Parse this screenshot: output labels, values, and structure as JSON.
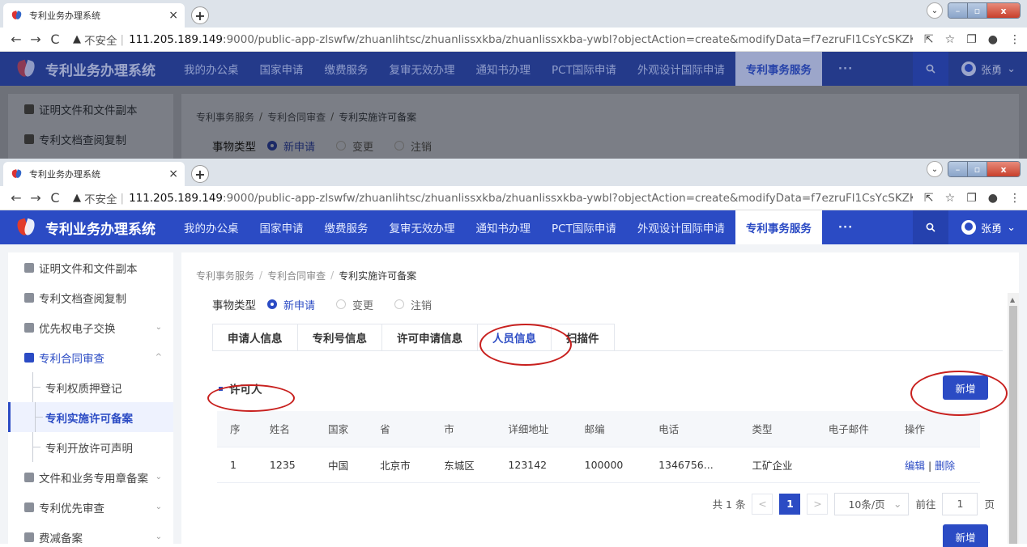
{
  "browser": {
    "tab_title": "专利业务办理系统",
    "tab_close": "×",
    "new_tab": "+",
    "dropdown": "⌄",
    "win_min": "–",
    "win_max": "▫",
    "win_close": "x",
    "back": "←",
    "forward": "→",
    "reload": "C",
    "insecure_label": "不安全",
    "url_host": "111.205.189.149",
    "url_path": ":9000/public-app-zlswfw/zhuanlihtsc/zhuanlissxkba/zhuanlissxkba-ywbl?objectAction=create&modifyData=f7ezruFl1CsYcSKZKB..."
  },
  "header": {
    "app_title": "专利业务办理系统",
    "nav": [
      "我的办公桌",
      "国家申请",
      "缴费服务",
      "复审无效办理",
      "通知书办理",
      "PCT国际申请",
      "外观设计国际申请",
      "专利事务服务",
      "···"
    ],
    "active_nav": "专利事务服务",
    "user_name": "张勇",
    "user_chevron": "⌄"
  },
  "sidebar": {
    "items": [
      {
        "label": "证明文件和文件副本"
      },
      {
        "label": "专利文档查阅复制"
      },
      {
        "label": "优先权电子交换",
        "chevron": "⌄"
      },
      {
        "label": "专利合同审查",
        "chevron": "^"
      }
    ],
    "subitems": [
      "专利权质押登记",
      "专利实施许可备案",
      "专利开放许可声明"
    ],
    "after_items": [
      {
        "label": "文件和业务专用章备案",
        "chevron": "⌄"
      },
      {
        "label": "专利优先审查",
        "chevron": "⌄"
      },
      {
        "label": "费减备案",
        "chevron": "⌄"
      }
    ]
  },
  "breadcrumb": {
    "items": [
      "专利事务服务",
      "专利合同审查",
      "专利实施许可备案"
    ],
    "sep": "/"
  },
  "matter_type": {
    "label": "事物类型",
    "options": [
      "新申请",
      "变更",
      "注销"
    ],
    "selected": "新申请"
  },
  "tabs": {
    "items": [
      "申请人信息",
      "专利号信息",
      "许可申请信息",
      "人员信息",
      "扫描件"
    ],
    "active": "人员信息"
  },
  "section": {
    "title": "许可人",
    "add_label": "新增"
  },
  "table": {
    "columns": [
      "序",
      "姓名",
      "国家",
      "省",
      "市",
      "详细地址",
      "邮编",
      "电话",
      "类型",
      "电子邮件",
      "操作"
    ],
    "rows": [
      {
        "seq": "1",
        "name": "1235",
        "country": "中国",
        "province": "北京市",
        "city": "东城区",
        "address": "123142",
        "zip": "100000",
        "phone": "1346756...",
        "type": "工矿企业",
        "email": "",
        "edit": "编辑",
        "sep": "|",
        "delete": "删除"
      }
    ]
  },
  "pager": {
    "total": "共 1 条",
    "prev": "<",
    "current": "1",
    "next": ">",
    "page_size": "10条/页",
    "page_size_chevron": "⌄",
    "goto_label": "前往",
    "goto_value": "1",
    "page_suffix": "页"
  },
  "bottom_add_label": "新增",
  "colors": {
    "primary": "#2b4bc4",
    "annotation_red": "#c8201e"
  }
}
